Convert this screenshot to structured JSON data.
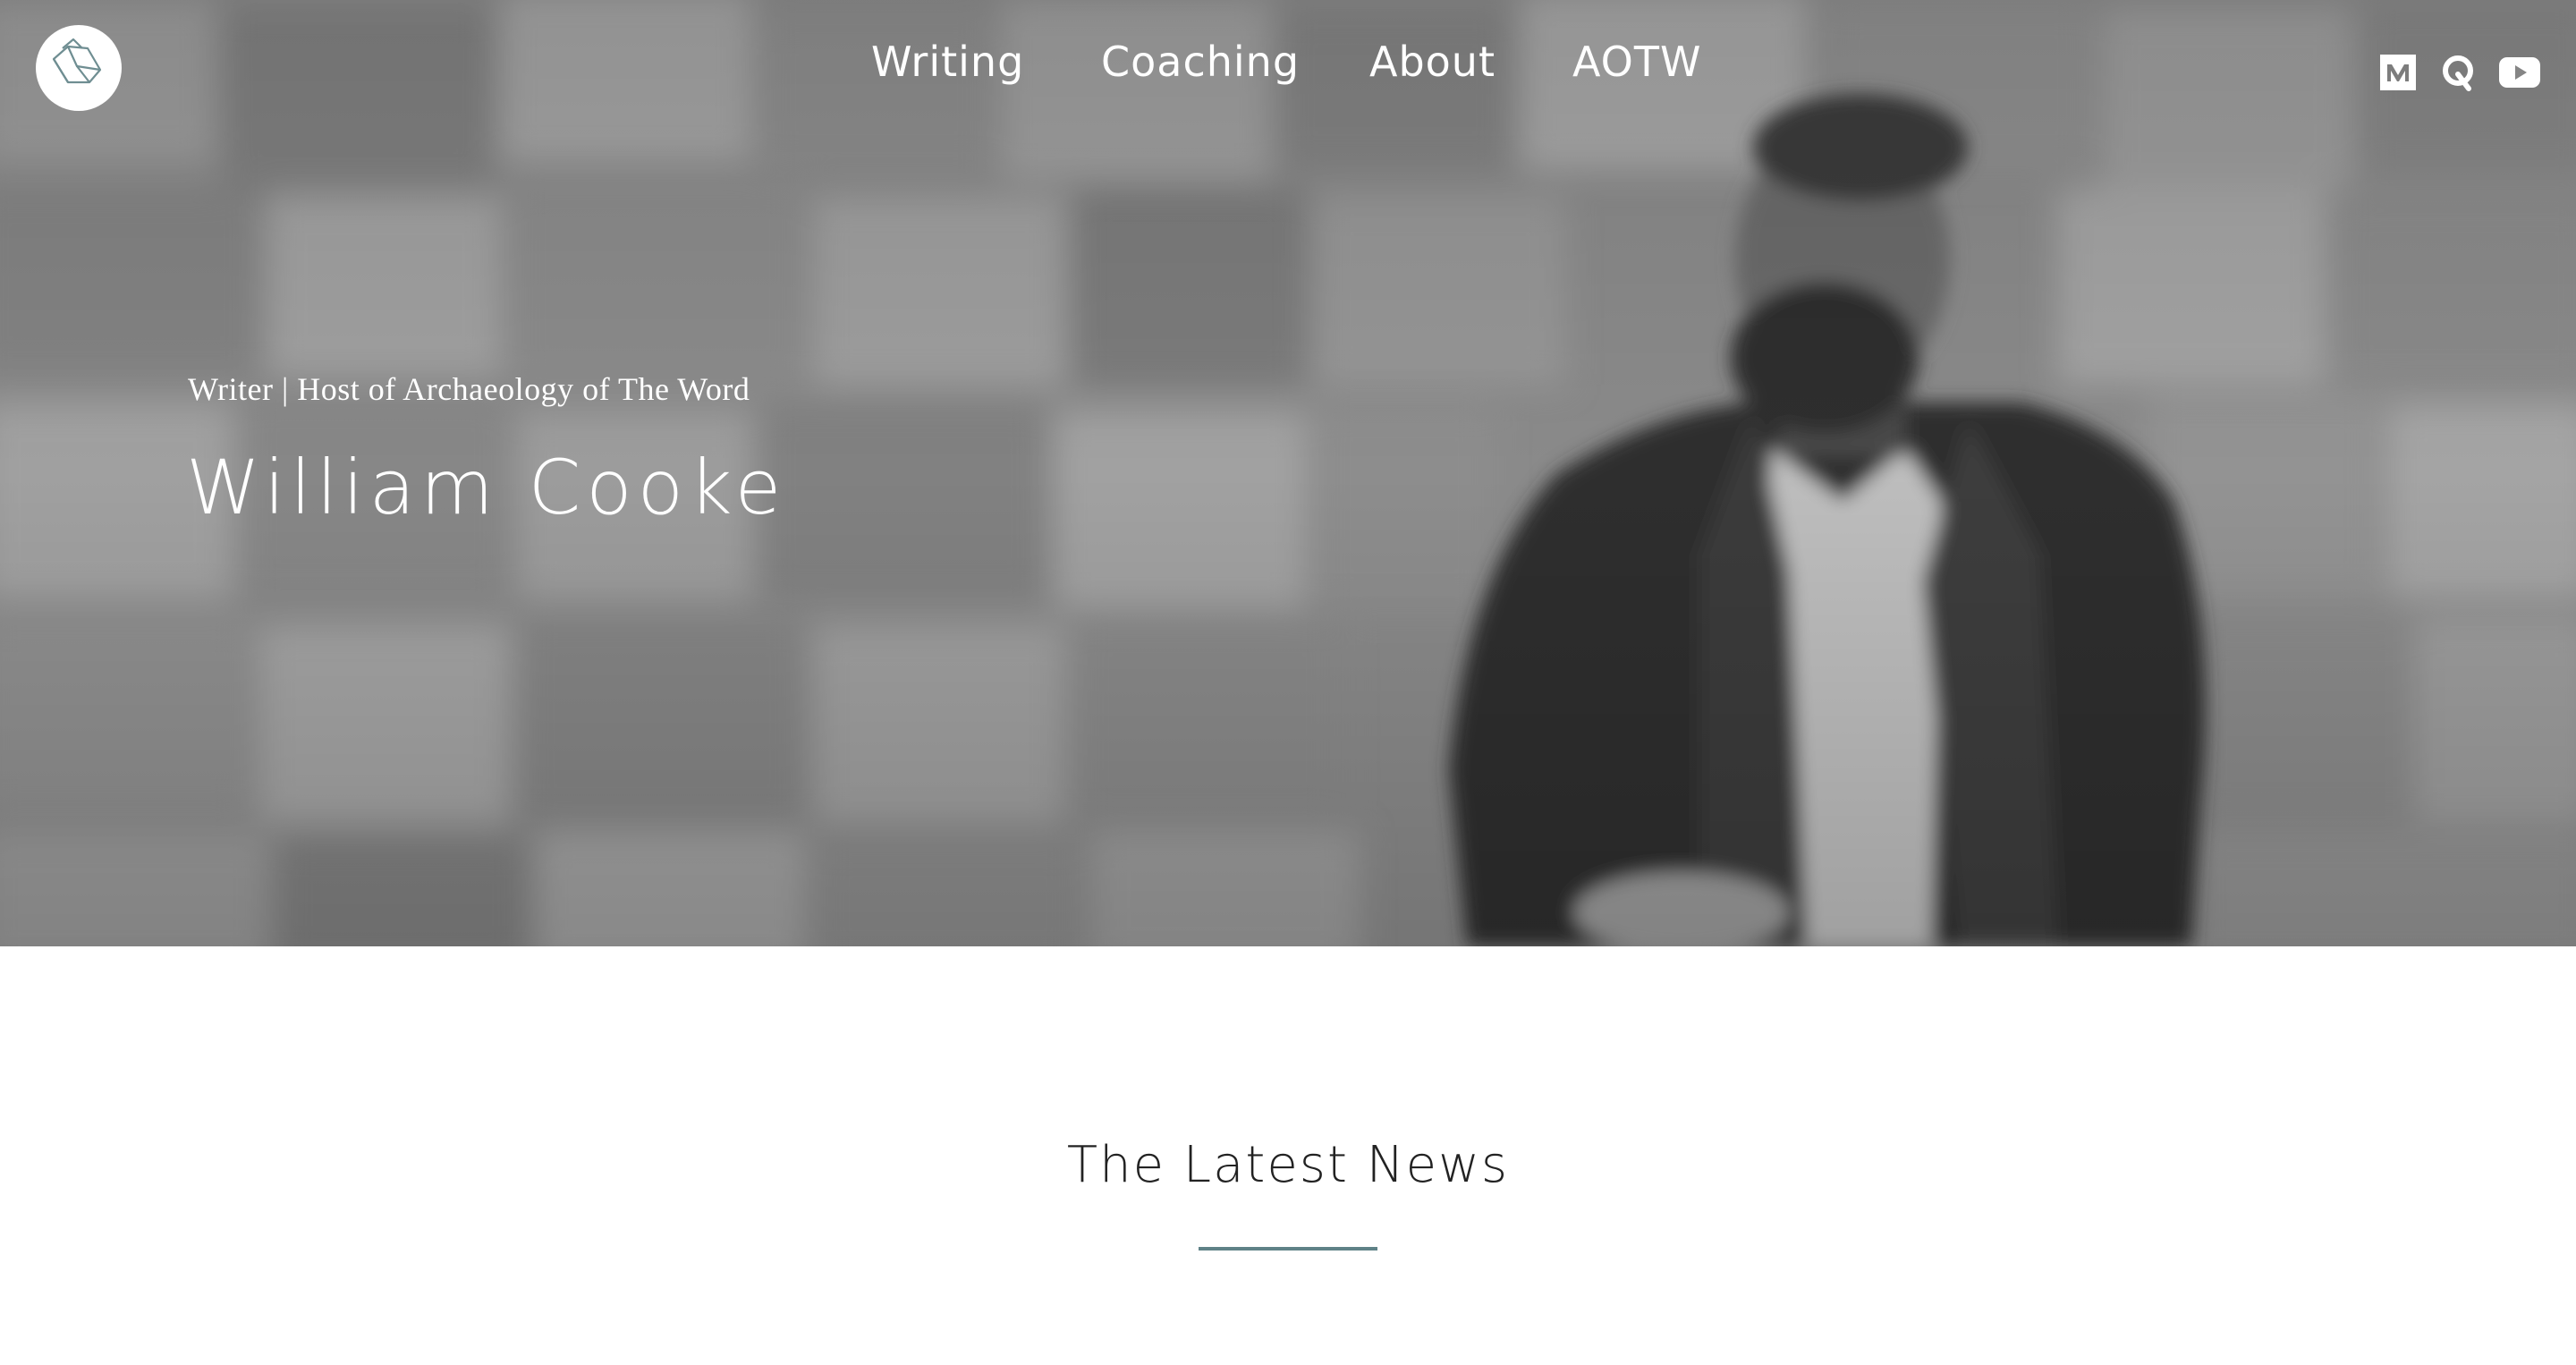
{
  "brand": {
    "logo_icon": "book-logo-icon"
  },
  "nav": {
    "items": [
      {
        "label": "Writing"
      },
      {
        "label": "Coaching"
      },
      {
        "label": "About"
      },
      {
        "label": "AOTW"
      }
    ]
  },
  "social": {
    "items": [
      {
        "icon": "medium-icon"
      },
      {
        "icon": "quora-icon"
      },
      {
        "icon": "youtube-icon"
      }
    ]
  },
  "hero": {
    "subtitle": "Writer | Host of Archaeology of The Word",
    "name": "William Cooke"
  },
  "latest": {
    "title": "The Latest News"
  },
  "colors": {
    "accent": "#5f8287",
    "logo_stroke": "#6f8e92",
    "hero_text": "#ffffff"
  }
}
